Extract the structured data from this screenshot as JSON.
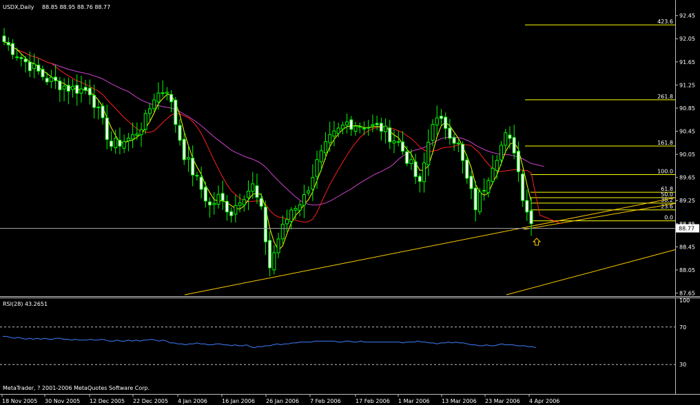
{
  "header": {
    "symbol": "USDX,Daily",
    "ohlc": "88.85 88.95 88.76 88.77"
  },
  "rsi": {
    "title": "RSI(28) 43.2651",
    "ticks": [
      "100",
      "70",
      "30"
    ],
    "levels": [
      70,
      30
    ],
    "values": [
      60,
      60,
      59,
      58,
      59,
      58,
      57,
      58,
      57,
      58,
      57,
      58,
      57,
      57,
      58,
      58,
      57,
      57,
      56,
      57,
      56,
      56,
      56,
      57,
      56,
      56,
      57,
      56,
      55,
      55,
      56,
      55,
      55,
      56,
      55,
      56,
      55,
      56,
      56,
      57,
      56,
      55,
      56,
      55,
      53,
      53,
      52,
      52,
      51,
      52,
      52,
      53,
      52,
      52,
      51,
      51,
      52,
      52,
      51,
      51,
      50,
      51,
      50,
      50,
      51,
      49,
      48,
      49,
      49,
      50,
      50,
      51,
      52,
      51,
      52,
      52,
      53,
      53,
      54,
      54,
      54,
      54,
      55,
      55,
      55,
      55,
      55,
      55,
      54,
      54,
      55,
      55,
      54,
      54,
      55,
      54,
      54,
      54,
      54,
      54,
      54,
      54,
      54,
      54,
      54,
      53,
      54,
      54,
      54,
      55,
      54,
      54,
      53,
      53,
      52,
      53,
      53,
      54,
      53,
      54,
      53,
      53,
      52,
      51,
      51,
      50,
      50,
      51,
      50,
      50,
      51,
      52,
      51,
      51,
      51,
      50,
      50,
      50,
      49,
      49,
      48
    ]
  },
  "footer": {
    "copyright": "MetaTrader, ? 2001-2006 MetaQuotes Software Corp."
  },
  "chart_data": {
    "type": "candlestick",
    "y_ticks": [
      "92.45",
      "92.05",
      "91.65",
      "91.25",
      "90.85",
      "90.45",
      "90.05",
      "89.65",
      "89.25",
      "88.85",
      "88.45",
      "88.05",
      "87.65"
    ],
    "ylim": [
      87.62,
      92.72
    ],
    "current_price": "88.77",
    "x_labels": [
      "18 Nov 2005",
      "30 Nov 2005",
      "12 Dec 2005",
      "22 Dec 2005",
      "4 Jan 2006",
      "16 Jan 2006",
      "26 Jan 2006",
      "7 Feb 2006",
      "17 Feb 2006",
      "1 Mar 2006",
      "13 Mar 2006",
      "23 Mar 2006",
      "4 Apr 2006"
    ],
    "fibonacci": [
      "423.6",
      "261.8",
      "161.8",
      "100.0",
      "61.8",
      "50.0",
      "38.2",
      "23.6",
      "0.0"
    ],
    "close_anchors": [
      [
        0,
        92.0
      ],
      [
        5,
        91.65
      ],
      [
        10,
        91.35
      ],
      [
        15,
        91.2
      ],
      [
        20,
        91.15
      ],
      [
        25,
        90.2
      ],
      [
        30,
        90.35
      ],
      [
        33,
        90.65
      ],
      [
        35,
        91.05
      ],
      [
        38,
        91.2
      ],
      [
        40,
        90.6
      ],
      [
        42,
        90.05
      ],
      [
        45,
        89.6
      ],
      [
        48,
        89.15
      ],
      [
        50,
        89.3
      ],
      [
        53,
        89.05
      ],
      [
        55,
        89.3
      ],
      [
        58,
        89.5
      ],
      [
        60,
        89.05
      ],
      [
        62,
        88.1
      ],
      [
        64,
        88.6
      ],
      [
        67,
        89.1
      ],
      [
        70,
        89.3
      ],
      [
        73,
        89.9
      ],
      [
        76,
        90.3
      ],
      [
        80,
        90.6
      ],
      [
        84,
        90.55
      ],
      [
        88,
        90.5
      ],
      [
        92,
        90.25
      ],
      [
        95,
        89.85
      ],
      [
        97,
        89.5
      ],
      [
        100,
        90.65
      ],
      [
        103,
        90.55
      ],
      [
        106,
        90.2
      ],
      [
        108,
        89.6
      ],
      [
        110,
        89.15
      ],
      [
        112,
        89.5
      ],
      [
        114,
        89.9
      ],
      [
        117,
        90.35
      ],
      [
        119,
        90.15
      ],
      [
        121,
        89.35
      ],
      [
        123,
        88.85
      ]
    ]
  }
}
